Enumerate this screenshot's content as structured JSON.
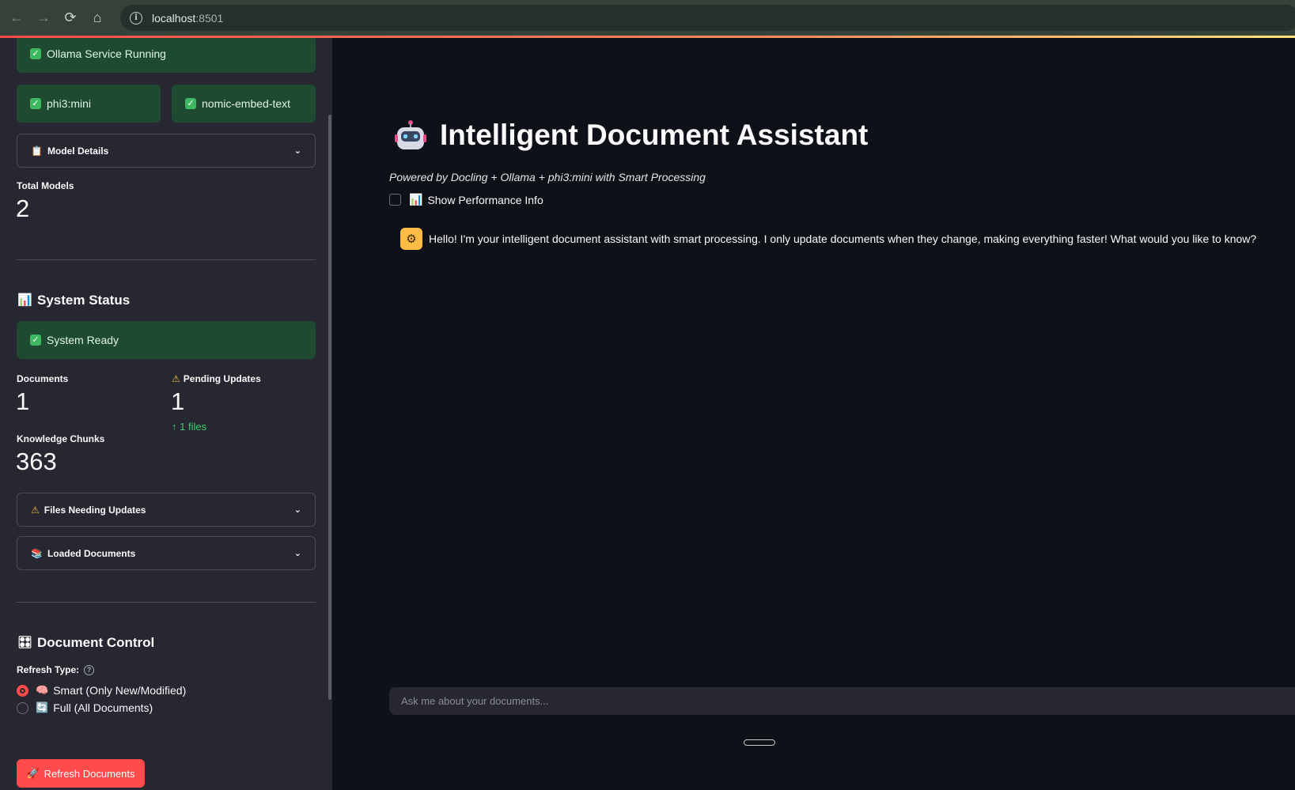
{
  "browser": {
    "url_host": "localhost",
    "url_port": ":8501"
  },
  "sidebar": {
    "ollama_status": "Ollama Service Running",
    "model_1": "phi3:mini",
    "model_2": "nomic-embed-text",
    "model_details": "Model Details",
    "total_models_label": "Total Models",
    "total_models_value": "2",
    "system_status_title": "System Status",
    "system_ready": "System Ready",
    "documents_label": "Documents",
    "documents_value": "1",
    "pending_label": "Pending Updates",
    "pending_value": "1",
    "pending_delta": "1 files",
    "chunks_label": "Knowledge Chunks",
    "chunks_value": "363",
    "files_needing_updates": "Files Needing Updates",
    "loaded_documents": "Loaded Documents",
    "document_control_title": "Document Control",
    "refresh_type_label": "Refresh Type:",
    "radio_smart": "Smart (Only New/Modified)",
    "radio_full": "Full (All Documents)",
    "refresh_button": "Refresh Documents"
  },
  "main": {
    "title": "Intelligent Document Assistant",
    "subtitle": "Powered by Docling + Ollama + phi3:mini with Smart Processing",
    "show_perf": "Show Performance Info",
    "assistant_message": "Hello! I'm your intelligent document assistant with smart processing. I only update documents when they change, making everything faster! What would you like to know?",
    "chat_placeholder": "Ask me about your documents..."
  },
  "colors": {
    "accent": "#ff4b4b",
    "success_bg": "#1f4a32",
    "sidebar_bg": "#262730",
    "main_bg": "#0e1117"
  }
}
